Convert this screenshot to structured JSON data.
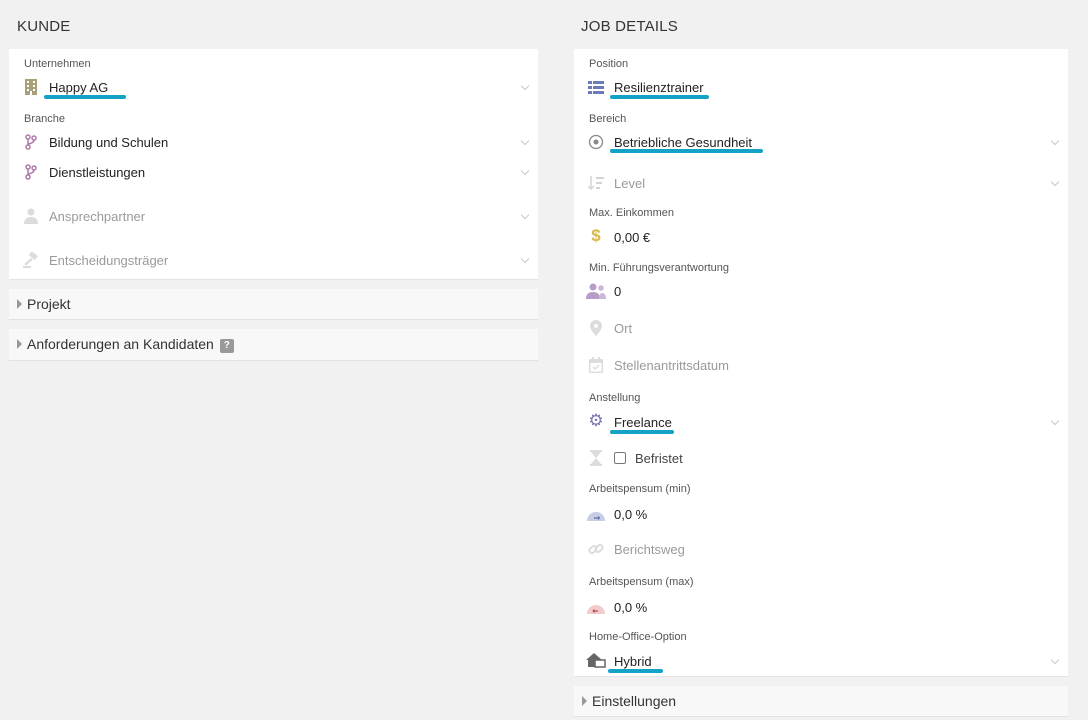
{
  "left": {
    "title": "KUNDE",
    "unternehmen": {
      "label": "Unternehmen",
      "value": "Happy AG"
    },
    "branche": {
      "label": "Branche",
      "values": [
        "Bildung und Schulen",
        "Dienstleistungen"
      ]
    },
    "ansprechpartner": {
      "placeholder": "Ansprechpartner"
    },
    "entscheidungstraeger": {
      "placeholder": "Entscheidungsträger"
    },
    "accordions": [
      {
        "label": "Projekt"
      },
      {
        "label": "Anforderungen an Kandidaten",
        "help": "?"
      }
    ]
  },
  "right": {
    "title": "JOB DETAILS",
    "position": {
      "label": "Position",
      "value": "Resilienztrainer"
    },
    "bereich": {
      "label": "Bereich",
      "value": "Betriebliche Gesundheit"
    },
    "level": {
      "placeholder": "Level"
    },
    "max_einkommen": {
      "label": "Max. Einkommen",
      "value": "0,00 €"
    },
    "fuehrung": {
      "label": "Min. Führungsverantwortung",
      "value": "0"
    },
    "ort": {
      "placeholder": "Ort"
    },
    "stellenantritt": {
      "placeholder": "Stellenantrittsdatum"
    },
    "anstellung": {
      "label": "Anstellung",
      "value": "Freelance"
    },
    "befristet": {
      "label": "Befristet",
      "checked": false
    },
    "pensum_min": {
      "label": "Arbeitspensum (min)",
      "value": "0,0 %"
    },
    "berichtsweg": {
      "placeholder": "Berichtsweg"
    },
    "pensum_max": {
      "label": "Arbeitspensum (max)",
      "value": "0,0 %"
    },
    "home_office": {
      "label": "Home-Office-Option",
      "value": "Hybrid"
    },
    "accordions": [
      {
        "label": "Einstellungen"
      }
    ]
  },
  "colors": {
    "underline": "#14a3c7",
    "building": "#a8a07a",
    "branch": "#b07aa6",
    "list": "#6a7bb8",
    "dollar": "#d6b84a"
  }
}
